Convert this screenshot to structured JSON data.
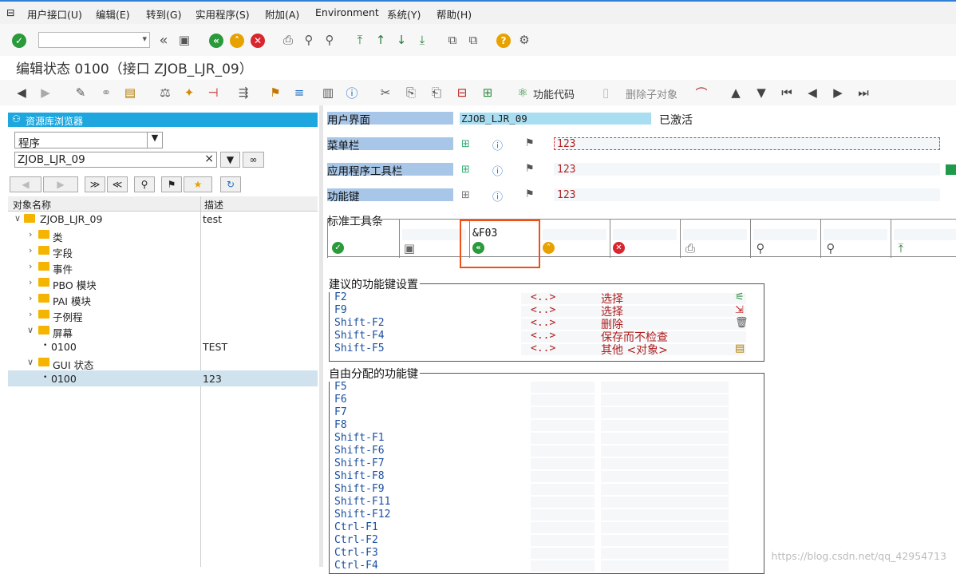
{
  "menubar": {
    "items": [
      "用户接口(U)",
      "编辑(E)",
      "转到(G)",
      "实用程序(S)",
      "附加(A)",
      "Environment",
      "系统(Y)",
      "帮助(H)"
    ]
  },
  "title": "编辑状态 0100（接口 ZJOB_LJR_09）",
  "app_toolbar": {
    "function_code_label": "功能代码",
    "delete_sub_label": "删除子对象"
  },
  "repo_browser": {
    "header": "资源库浏览器",
    "object_type": "程序",
    "object_name": "ZJOB_LJR_09",
    "clear_symbol": "×",
    "columns": {
      "name": "对象名称",
      "desc": "描述"
    },
    "tree": [
      {
        "label": "ZJOB_LJR_09",
        "desc": "test"
      },
      {
        "label": "类",
        "desc": ""
      },
      {
        "label": "字段",
        "desc": ""
      },
      {
        "label": "事件",
        "desc": ""
      },
      {
        "label": "PBO 模块",
        "desc": ""
      },
      {
        "label": "PAI 模块",
        "desc": ""
      },
      {
        "label": "子例程",
        "desc": ""
      },
      {
        "label": "屏幕",
        "desc": ""
      },
      {
        "label": "0100",
        "desc": "TEST"
      },
      {
        "label": "GUI 状态",
        "desc": ""
      },
      {
        "label": "0100",
        "desc": "123"
      }
    ]
  },
  "ui": {
    "user_interface_label": "用户界面",
    "user_interface_value": "ZJOB_LJR_09",
    "status": "已激活",
    "menubar_label": "菜单栏",
    "menubar_value": "123",
    "app_toolbar_label": "应用程序工具栏",
    "app_toolbar_value": "123",
    "fkeys_label": "功能键",
    "fkeys_value": "123"
  },
  "std_toolbar": {
    "label": "标准工具条",
    "selected_code": "&F03"
  },
  "proposed_fkeys": {
    "title": "建议的功能键设置",
    "rows": [
      {
        "key": "F2",
        "code": "<..>",
        "text": "选择"
      },
      {
        "key": "F9",
        "code": "<..>",
        "text": "选择"
      },
      {
        "key": "Shift-F2",
        "code": "<..>",
        "text": "删除"
      },
      {
        "key": "Shift-F4",
        "code": "<..>",
        "text": "保存而不检查"
      },
      {
        "key": "Shift-F5",
        "code": "<..>",
        "text": "其他 <对象>"
      }
    ]
  },
  "free_fkeys": {
    "title": "自由分配的功能键",
    "keys": [
      "F5",
      "F6",
      "F7",
      "F8",
      "Shift-F1",
      "Shift-F6",
      "Shift-F7",
      "Shift-F8",
      "Shift-F9",
      "Shift-F11",
      "Shift-F12",
      "Ctrl-F1",
      "Ctrl-F2",
      "Ctrl-F3",
      "Ctrl-F4"
    ]
  },
  "watermark": "https://blog.csdn.net/qq_42954713"
}
